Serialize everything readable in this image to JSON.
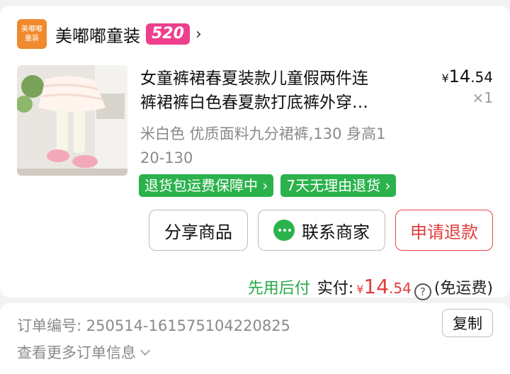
{
  "shop": {
    "logo_text": "美嘟嘟童装",
    "name": "美嘟嘟童装",
    "badge": "520"
  },
  "product": {
    "title_line1": "女童裤裙春夏装款儿童假两件连",
    "title_line2": "裤裙裤白色春夏款打底裤外穿…",
    "price_currency": "¥",
    "price_int": "14",
    "price_dec": ".54",
    "quantity": "×1",
    "spec_line1": "米白色 优质面料九分裙裤,130 身高1",
    "spec_line2": "20-130",
    "tags": [
      "退货包运费保障中",
      "7天无理由退货"
    ]
  },
  "actions": {
    "share": "分享商品",
    "contact": "联系商家",
    "refund": "申请退款"
  },
  "total": {
    "pay_later": "先用后付",
    "paid_label": "实付:",
    "currency": "¥",
    "amount_int": "14",
    "amount_dec": ".54",
    "help": "?",
    "shipping": "(免运费)"
  },
  "order": {
    "number_label": "订单编号:",
    "number": "250514-161575104220825",
    "copy": "复制",
    "more": "查看更多订单信息"
  },
  "colors": {
    "accent_red": "#e23a3a",
    "green": "#2bb24c",
    "badge_pink": "#ef3f8e",
    "logo_orange": "#f08a2e"
  }
}
